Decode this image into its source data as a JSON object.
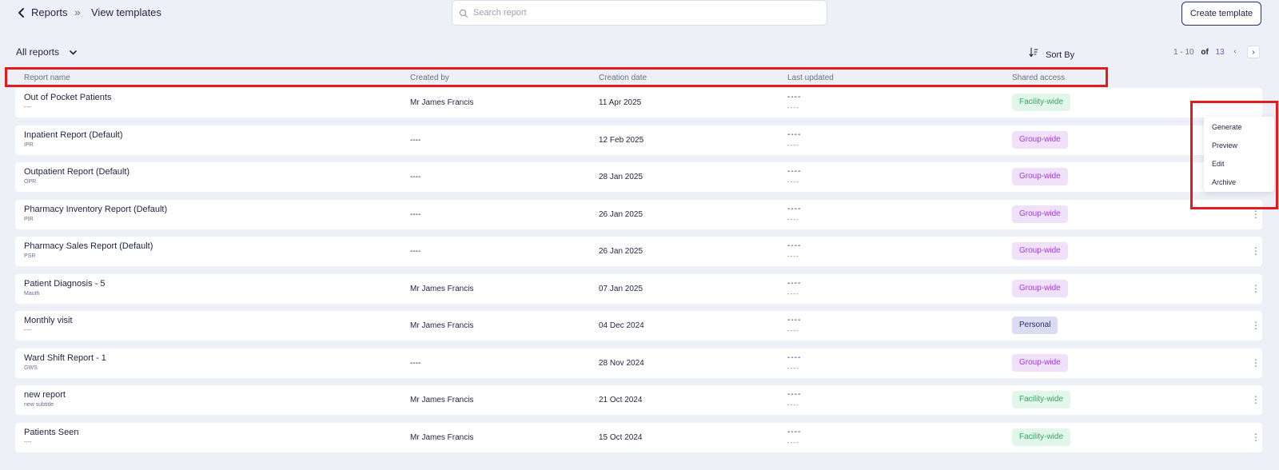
{
  "breadcrumb": {
    "back_icon": "chevron-left-icon",
    "parent": "Reports",
    "separator": "»",
    "current": "View templates"
  },
  "search": {
    "placeholder": "Search report",
    "icon": "search-icon"
  },
  "actions": {
    "create_label": "Create template"
  },
  "filter": {
    "label": "All reports",
    "icon": "chevron-down-icon"
  },
  "sort": {
    "label": "Sort By",
    "icon": "sort-icon"
  },
  "pagination": {
    "range": "1 - 10",
    "of": "of",
    "total": "13",
    "prev": "‹",
    "next": "›"
  },
  "columns": {
    "name": "Report name",
    "created_by": "Created by",
    "creation_date": "Creation date",
    "last_updated": "Last updated",
    "shared_access": "Shared access"
  },
  "rows": [
    {
      "name": "Out of Pocket Patients",
      "subtitle": "----",
      "created_by": "Mr James Francis",
      "date": "11 Apr 2025",
      "updated": "----",
      "updated_sub": "----",
      "access": "Facility-wide",
      "access_type": "facility"
    },
    {
      "name": "Inpatient Report (Default)",
      "subtitle": "IPR",
      "created_by": "----",
      "date": "12 Feb 2025",
      "updated": "----",
      "updated_sub": "----",
      "access": "Group-wide",
      "access_type": "group"
    },
    {
      "name": "Outpatient Report (Default)",
      "subtitle": "OPR",
      "created_by": "----",
      "date": "28 Jan 2025",
      "updated": "----",
      "updated_sub": "----",
      "access": "Group-wide",
      "access_type": "group"
    },
    {
      "name": "Pharmacy Inventory Report (Default)",
      "subtitle": "PIR",
      "created_by": "----",
      "date": "26 Jan 2025",
      "updated": "----",
      "updated_sub": "----",
      "access": "Group-wide",
      "access_type": "group"
    },
    {
      "name": "Pharmacy Sales Report (Default)",
      "subtitle": "PSR",
      "created_by": "----",
      "date": "26 Jan 2025",
      "updated": "----",
      "updated_sub": "----",
      "access": "Group-wide",
      "access_type": "group"
    },
    {
      "name": "Patient Diagnosis - 5",
      "subtitle": "Mauth",
      "created_by": "Mr James Francis",
      "date": "07 Jan 2025",
      "updated": "----",
      "updated_sub": "----",
      "access": "Group-wide",
      "access_type": "group"
    },
    {
      "name": "Monthly visit",
      "subtitle": "----",
      "created_by": "Mr James Francis",
      "date": "04 Dec 2024",
      "updated": "----",
      "updated_sub": "----",
      "access": "Personal",
      "access_type": "personal"
    },
    {
      "name": "Ward Shift Report - 1",
      "subtitle": "GWS",
      "created_by": "----",
      "date": "28 Nov 2024",
      "updated": "----",
      "updated_sub": "----",
      "access": "Group-wide",
      "access_type": "group"
    },
    {
      "name": "new report",
      "subtitle": "new subtitle",
      "created_by": "Mr James Francis",
      "date": "21 Oct 2024",
      "updated": "----",
      "updated_sub": "----",
      "access": "Facility-wide",
      "access_type": "facility"
    },
    {
      "name": "Patients Seen",
      "subtitle": "----",
      "created_by": "Mr James Francis",
      "date": "15 Oct 2024",
      "updated": "----",
      "updated_sub": "----",
      "access": "Facility-wide",
      "access_type": "facility"
    }
  ],
  "row_menu_icon": "more-vertical-icon",
  "context_menu": {
    "items": [
      "Generate",
      "Preview",
      "Edit",
      "Archive"
    ]
  },
  "colors": {
    "background": "#eef0f8",
    "facility_bg": "#e3f6ea",
    "facility_fg": "#2fa865",
    "group_bg": "#f0e0fa",
    "group_fg": "#9b3fd6",
    "personal_bg": "#d9dcf3",
    "personal_fg": "#2b2f6b",
    "highlight": "#e21c1c"
  }
}
